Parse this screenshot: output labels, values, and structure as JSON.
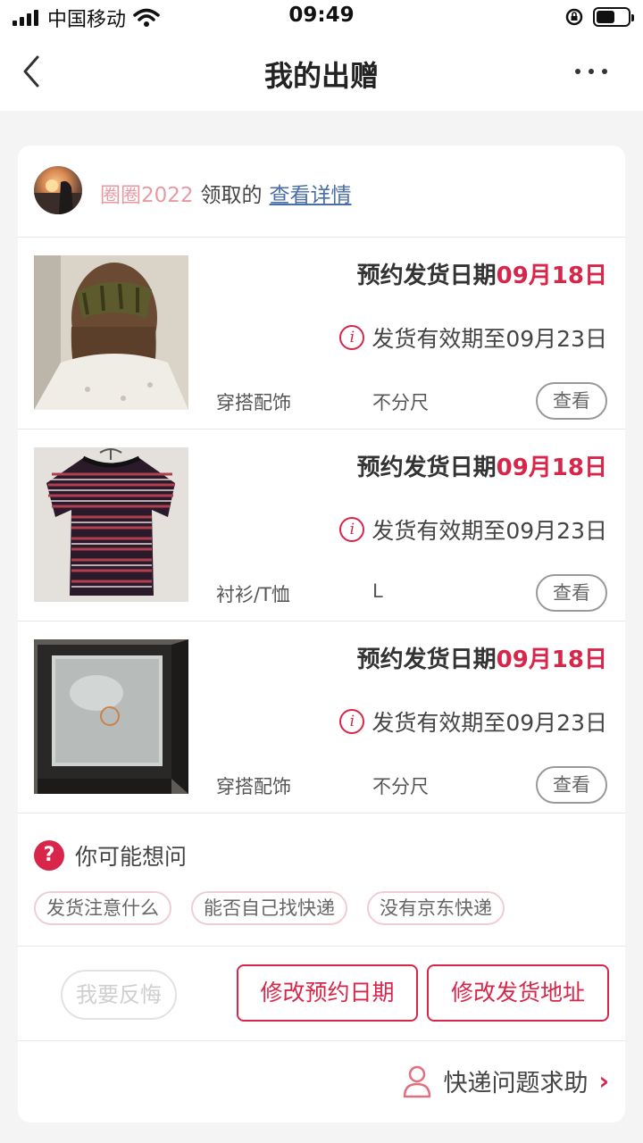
{
  "status_bar": {
    "carrier": "中国移动",
    "time": "09:49"
  },
  "nav": {
    "title": "我的出赠"
  },
  "receiver": {
    "username": "圈圈2022",
    "verb": "领取的",
    "detail_link": "查看详情"
  },
  "items": [
    {
      "date_prefix": "预约发货日期",
      "date": "09月18日",
      "valid_text": "发货有效期至09月23日",
      "category": "穿搭配饰",
      "size": "不分尺",
      "view_label": "查看"
    },
    {
      "date_prefix": "预约发货日期",
      "date": "09月18日",
      "valid_text": "发货有效期至09月23日",
      "category": "衬衫/T恤",
      "size": "L",
      "view_label": "查看"
    },
    {
      "date_prefix": "预约发货日期",
      "date": "09月18日",
      "valid_text": "发货有效期至09月23日",
      "category": "穿搭配饰",
      "size": "不分尺",
      "view_label": "查看"
    }
  ],
  "faq": {
    "title": "你可能想问",
    "chips": [
      "发货注意什么",
      "能否自己找快递",
      "没有京东快递"
    ]
  },
  "actions": {
    "regret": "我要反悔",
    "change_date": "修改预约日期",
    "change_address": "修改发货地址"
  },
  "help": {
    "label": "快递问题求助"
  },
  "colors": {
    "accent": "#d8264a",
    "username": "#e89aa2",
    "link": "#4a6ea8"
  }
}
